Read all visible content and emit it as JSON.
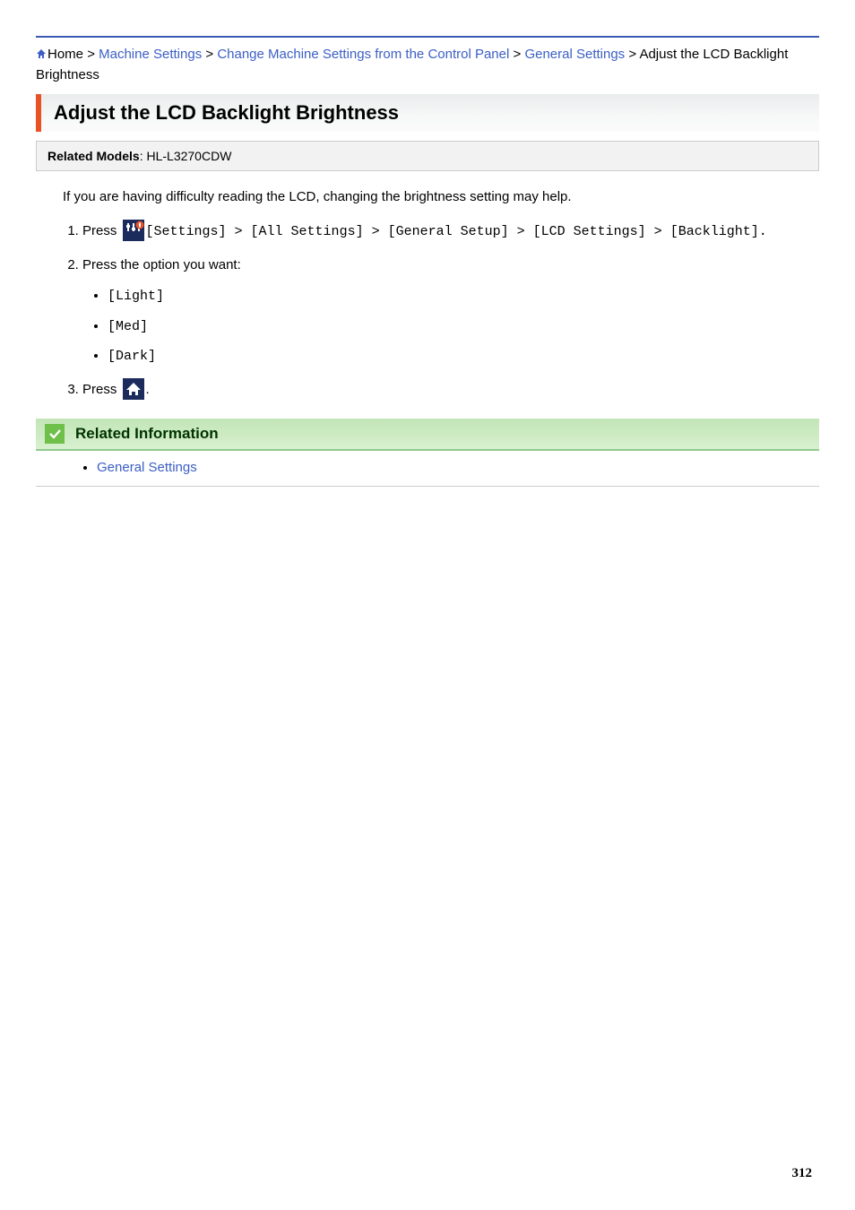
{
  "breadcrumb": {
    "home": "Home",
    "sep": ">",
    "items": [
      "Machine Settings",
      "Change Machine Settings from the Control Panel",
      "General Settings"
    ],
    "tail": "Adjust the LCD Backlight Brightness"
  },
  "title": "Adjust the LCD Backlight Brightness",
  "models_label": "Related Models",
  "models_value": ": HL-L3270CDW",
  "intro": "If you are having difficulty reading the LCD, changing the brightness setting may help.",
  "step1": {
    "press": "Press ",
    "p1": "[Settings]",
    "p2": "[All Settings]",
    "p3": "[General Setup]",
    "p4": "[LCD Settings]",
    "p5": "[Backlight]",
    "sep": " > ",
    "end": "."
  },
  "step2": {
    "text": "Press the option you want:",
    "opts": [
      "[Light]",
      "[Med]",
      "[Dark]"
    ]
  },
  "step3": {
    "press": "Press ",
    "end": "."
  },
  "related": {
    "title": "Related Information",
    "links": [
      "General Settings"
    ]
  },
  "page_number": "312"
}
